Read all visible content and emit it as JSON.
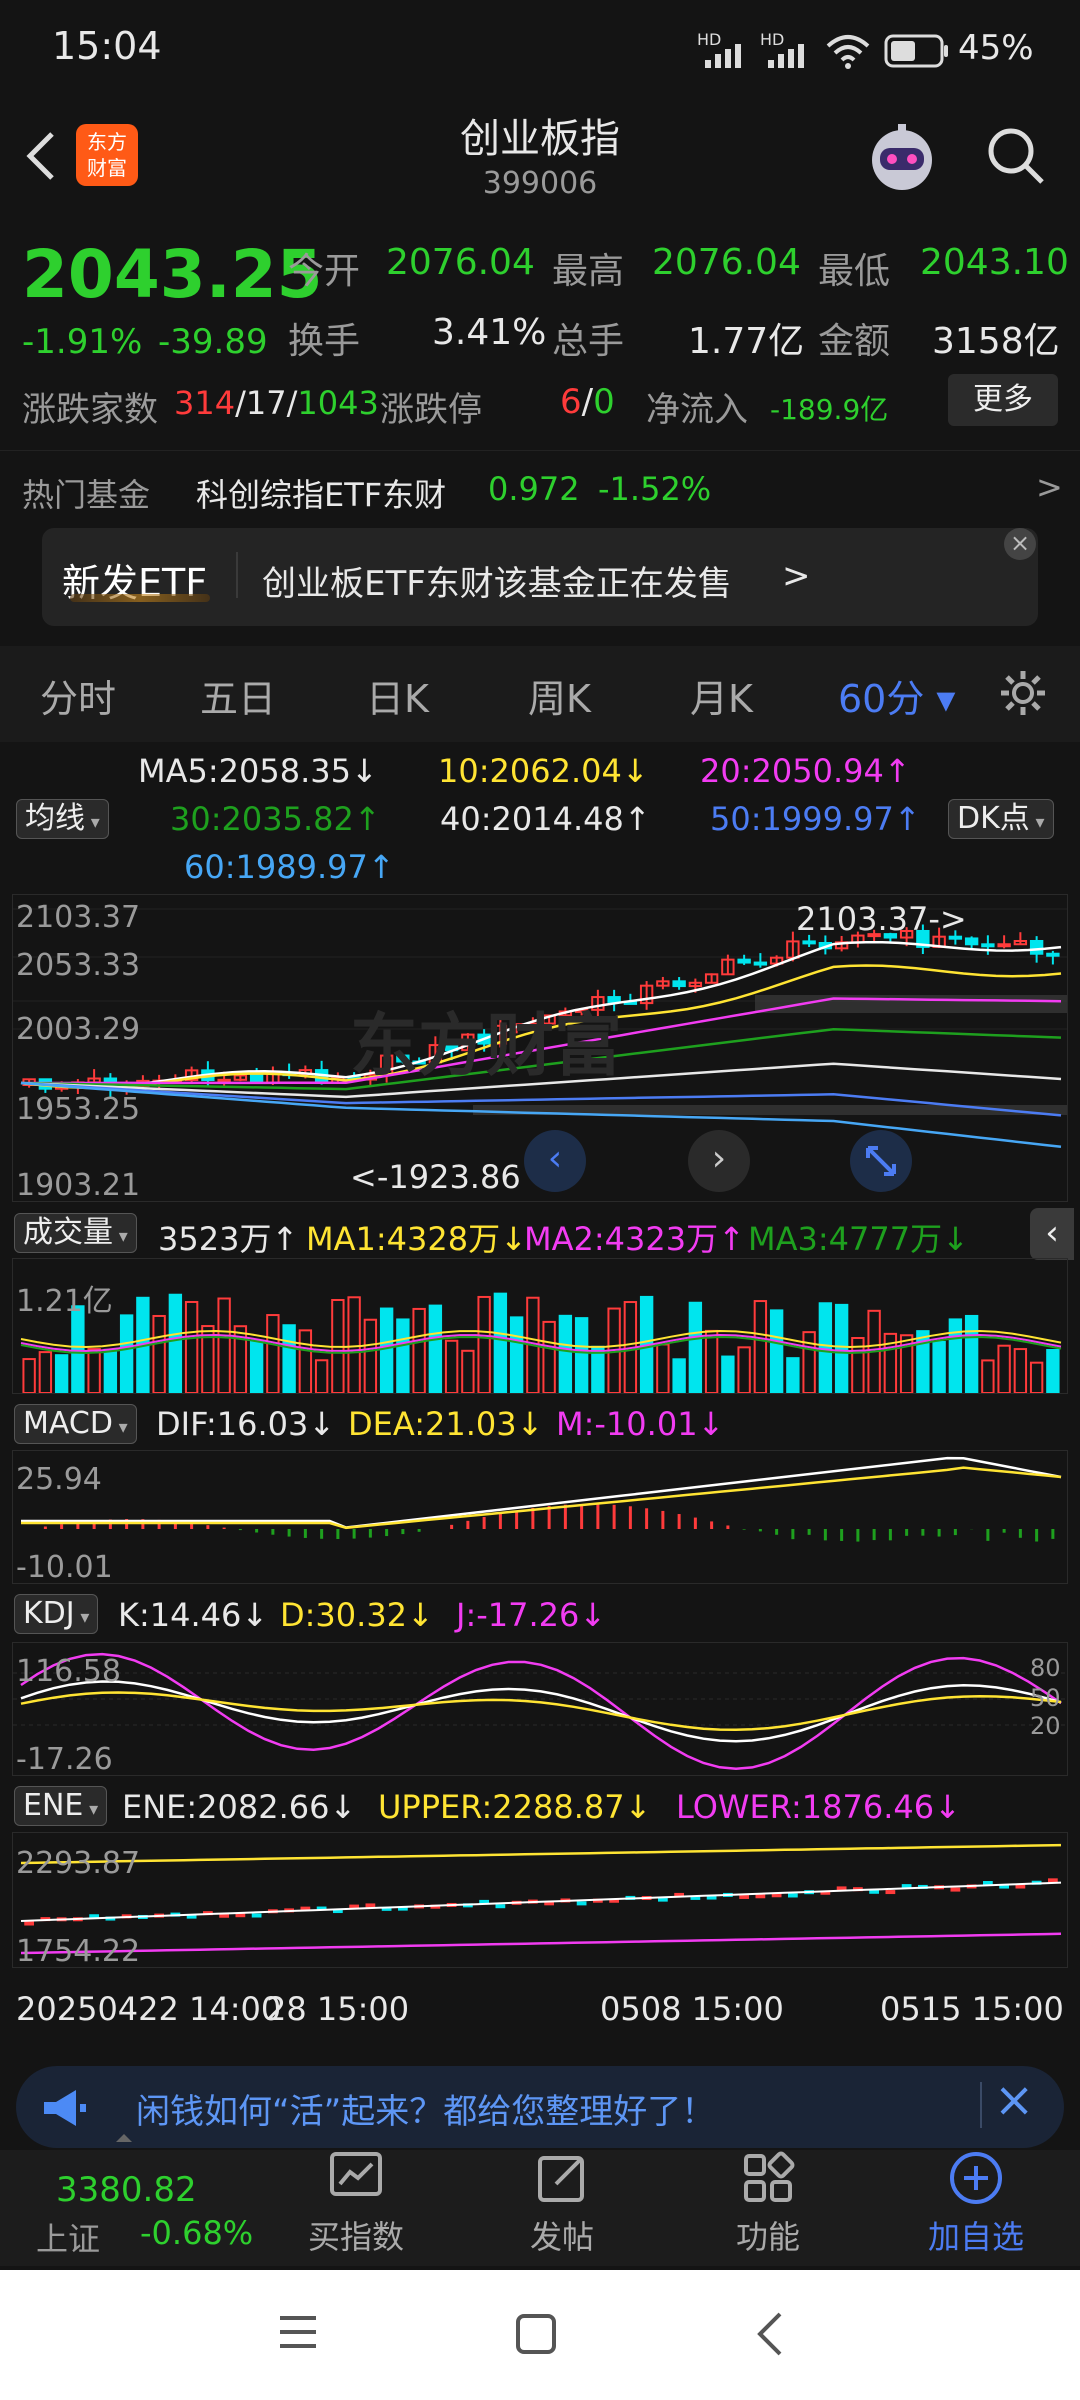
{
  "status": {
    "time": "15:04",
    "battery": "45%",
    "hd1": "HD",
    "hd2": "HD"
  },
  "header": {
    "logo_line1": "东方",
    "logo_line2": "财富",
    "title": "创业板指",
    "code": "399006"
  },
  "quote": {
    "price": "2043.25",
    "change_pct": "-1.91%",
    "change": "-39.89",
    "open_label": "今开",
    "open": "2076.04",
    "high_label": "最高",
    "high": "2076.04",
    "low_label": "最低",
    "low": "2043.10",
    "turnover_label": "换手",
    "turnover": "3.41%",
    "volume_label": "总手",
    "volume": "1.77亿",
    "amount_label": "金额",
    "amount": "3158亿",
    "counts_label": "涨跌家数",
    "up_count": "314",
    "flat_count": "17",
    "down_count": "1043",
    "sep": "/",
    "limit_label": "涨跌停",
    "limit_up": "6",
    "limit_down": "0",
    "netflow_label": "净流入",
    "netflow": "-189.9亿",
    "more": "更多"
  },
  "hot_fund": {
    "label": "热门基金",
    "name": "科创综指ETF东财",
    "price": "0.972",
    "pct": "-1.52%",
    "arrow": ">"
  },
  "banner": {
    "tag": "新发ETF",
    "text": "创业板ETF东财该基金正在发售",
    "arrow": ">",
    "close": "×"
  },
  "tabs": [
    "分时",
    "五日",
    "日K",
    "周K",
    "月K",
    "60分 ▾"
  ],
  "ma": {
    "select": "均线",
    "ma5": "MA5:2058.35↓",
    "ma10": "10:2062.04↓",
    "ma20": "20:2050.94↑",
    "ma30": "30:2035.82↑",
    "ma40": "40:2014.48↑",
    "ma50": "50:1999.97↑",
    "ma60": "60:1989.97↑",
    "dk": "DK点"
  },
  "kline": {
    "y1": "2103.37",
    "y2": "2053.33",
    "y3": "2003.29",
    "y4": "1953.25",
    "y5": "1903.21",
    "max_label": "2103.37->",
    "min_label": "<-1923.86",
    "watermark": "东方财富"
  },
  "vol": {
    "select": "成交量",
    "v": "3523万↑",
    "ma1": "MA1:4328万↓",
    "ma2": "MA2:4323万↑",
    "ma3": "MA3:4777万↓",
    "ytop": "1.21亿"
  },
  "macd": {
    "select": "MACD",
    "dif": "DIF:16.03↓",
    "dea": "DEA:21.03↓",
    "m": "M:-10.01↓",
    "ytop": "25.94",
    "ybot": "-10.01"
  },
  "kdj": {
    "select": "KDJ",
    "k": "K:14.46↓",
    "d": "D:30.32↓",
    "j": "J:-17.26↓",
    "ytop": "116.58",
    "ybot": "-17.26",
    "r80": "80",
    "r50": "50",
    "r20": "20"
  },
  "ene": {
    "select": "ENE",
    "ene": "ENE:2082.66↓",
    "upper": "UPPER:2288.87↓",
    "lower": "LOWER:1876.46↓",
    "ytop": "2293.87",
    "ybot": "1754.22"
  },
  "xaxis": {
    "d1": "20250422 14:00",
    "d2": "28 15:00",
    "d3": "0508 15:00",
    "d4": "0515 15:00"
  },
  "notice": {
    "text": "闲钱如何“活”起来？都给您整理好了！",
    "close": "×"
  },
  "bottom": {
    "index_value": "3380.82",
    "index_name": "上证",
    "index_pct": "-0.68%",
    "b1": "买指数",
    "b2": "发帖",
    "b3": "功能",
    "b4": "加自选"
  },
  "colors": {
    "up": "#ff3b3b",
    "down": "#00e5ee",
    "green": "#2ed02e",
    "accent": "#4c7cf3"
  }
}
